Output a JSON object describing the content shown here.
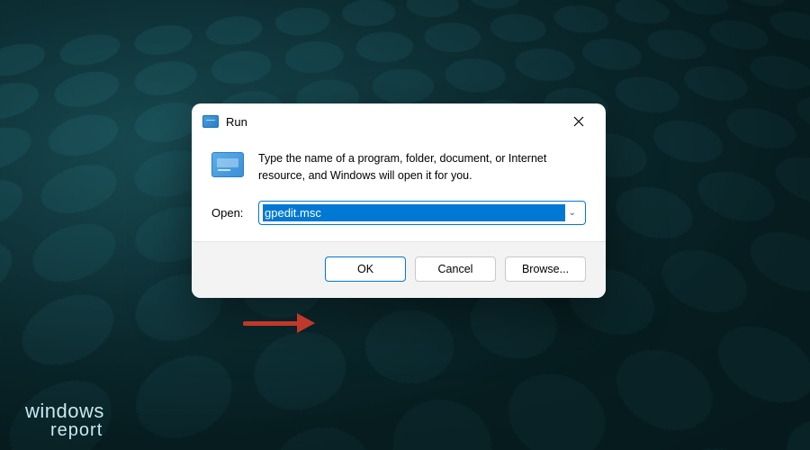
{
  "dialog": {
    "title": "Run",
    "description": "Type the name of a program, folder, document, or Internet resource, and Windows will open it for you.",
    "open_label": "Open:",
    "input_value": "gpedit.msc",
    "buttons": {
      "ok": "OK",
      "cancel": "Cancel",
      "browse": "Browse..."
    }
  },
  "watermark": {
    "line1": "windows",
    "line2": "report"
  },
  "annotation": {
    "arrow_color": "#c0392b"
  }
}
